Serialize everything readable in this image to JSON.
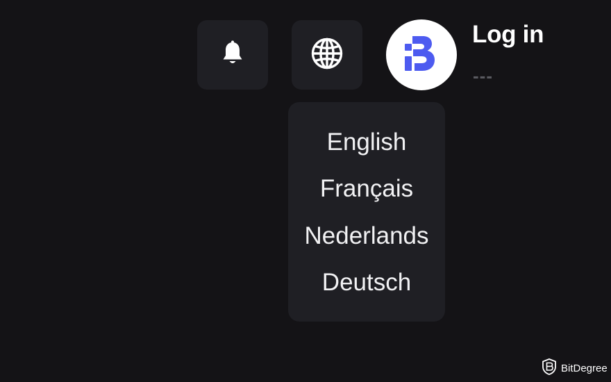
{
  "header": {
    "notifications_icon": "bell-icon",
    "language_icon": "globe-icon",
    "avatar_icon": "bitdegree-logo",
    "login_label": "Log in",
    "login_subtext": "---"
  },
  "language_menu": {
    "items": [
      {
        "label": "English"
      },
      {
        "label": "Français"
      },
      {
        "label": "Nederlands"
      },
      {
        "label": "Deutsch"
      }
    ]
  },
  "watermark": {
    "text": "BitDegree"
  },
  "colors": {
    "background": "#141316",
    "panel": "#1f1f24",
    "brand_blue": "#4d5bf0",
    "text": "#ffffff",
    "muted": "#5a5a60"
  }
}
